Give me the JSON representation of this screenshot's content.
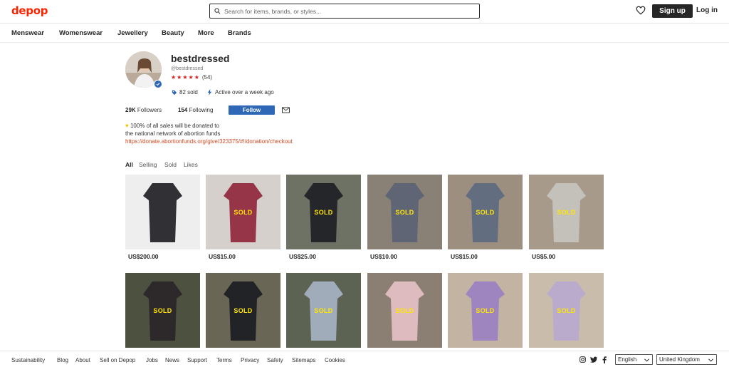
{
  "header": {
    "logo": "depop",
    "search_placeholder": "Search for items, brands, or styles...",
    "signup_label": "Sign up",
    "login_label": "Log in"
  },
  "nav": [
    "Menswear",
    "Womenswear",
    "Jewellery",
    "Beauty",
    "More",
    "Brands"
  ],
  "profile": {
    "name": "bestdressed",
    "handle": "@bestdressed",
    "rating_stars": 5,
    "rating_count": "(54)",
    "sold": "82 sold",
    "active": "Active over a week ago",
    "followers_count": "29K",
    "followers_label": "Followers",
    "following_count": "154",
    "following_label": "Following",
    "follow_label": "Follow",
    "bio_line1": "100% of all sales will be donated to",
    "bio_line2": "the national network of abortion funds",
    "bio_link": "https://donate.abortionfunds.org/give/323375/#!/donation/checkout"
  },
  "tabs": [
    "All",
    "Selling",
    "Sold",
    "Likes"
  ],
  "items": [
    {
      "price": "US$200.00",
      "sold": "",
      "bg": "#eeeeee",
      "fg": "#1c1c20"
    },
    {
      "price": "US$15.00",
      "sold": "SOLD",
      "bg": "#d5d0cb",
      "fg": "#8e2438"
    },
    {
      "price": "US$25.00",
      "sold": "SOLD",
      "bg": "#6e7264",
      "fg": "#1d1e24"
    },
    {
      "price": "US$10.00",
      "sold": "SOLD",
      "bg": "#8a8176",
      "fg": "#5b6277"
    },
    {
      "price": "US$15.00",
      "sold": "SOLD",
      "bg": "#9c8f80",
      "fg": "#5c6a80"
    },
    {
      "price": "US$5.00",
      "sold": "SOLD",
      "bg": "#a79a8a",
      "fg": "#c8c5c0"
    },
    {
      "price": "",
      "sold": "SOLD",
      "bg": "#4c5140",
      "fg": "#2a2428"
    },
    {
      "price": "",
      "sold": "SOLD",
      "bg": "#6a6655",
      "fg": "#1a1c22"
    },
    {
      "price": "",
      "sold": "SOLD",
      "bg": "#5d6353",
      "fg": "#a8b4c6"
    },
    {
      "price": "",
      "sold": "SOLD",
      "bg": "#8a7f72",
      "fg": "#e7c2c7"
    },
    {
      "price": "",
      "sold": "SOLD",
      "bg": "#c2b3a2",
      "fg": "#9b7fc3"
    },
    {
      "price": "",
      "sold": "SOLD",
      "bg": "#c9bcab",
      "fg": "#b8a8d0"
    }
  ],
  "footer": {
    "links": [
      "Sustainability",
      "Blog",
      "About",
      "Sell on Depop",
      "Jobs",
      "News",
      "Support",
      "Terms",
      "Privacy",
      "Safety",
      "Sitemaps",
      "Cookies"
    ],
    "language": "English",
    "country": "United Kingdom"
  },
  "colors": {
    "brand": "#ff2300",
    "follow": "#2d67b5",
    "star": "#d61e1e",
    "sold": "#ffe600",
    "link": "#d64a24"
  }
}
